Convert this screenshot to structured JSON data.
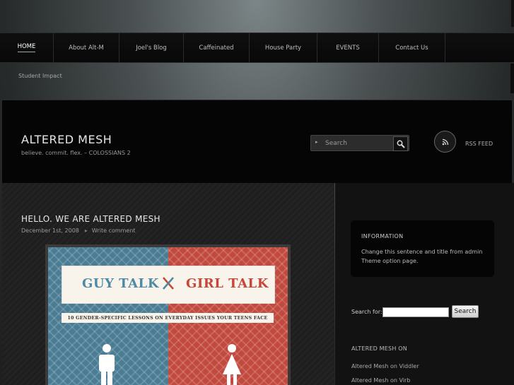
{
  "nav": {
    "items": [
      {
        "label": "HOME"
      },
      {
        "label": "About Alt-M"
      },
      {
        "label": "Joel's Blog"
      },
      {
        "label": "Caffeinated"
      },
      {
        "label": "House Party"
      },
      {
        "label": "EVENTS"
      },
      {
        "label": "Contact Us"
      }
    ],
    "subnav": "Student Impact"
  },
  "header": {
    "title": "ALTERED MESH",
    "tagline": "believe. commit. flex. – COLOSSIANS 2",
    "search_placeholder": "Search",
    "rss_label": "RSS FEED"
  },
  "post": {
    "title": "HELLO. WE ARE ALTERED MESH",
    "date": "December 1st, 2008",
    "comment_link": "Write comment",
    "image": {
      "left_title": "GUY TALK",
      "right_title": "GIRL TALK",
      "subtitle": "10 GENDER-SPECIFIC LESSONS ON EVERYDAY ISSUES YOUR TEENS FACE"
    }
  },
  "sidebar": {
    "info": {
      "title": "INFORMATION",
      "text": "Change this sentence and title from admin Theme option page."
    },
    "search": {
      "label": "Search for:",
      "button": "Search",
      "value": ""
    },
    "altered_mesh_on": {
      "title": "ALTERED MESH ON",
      "links": [
        "Altered Mesh on Viddler",
        "Altered Mesh on Virb"
      ]
    }
  },
  "colors": {
    "guy_blue": "#4d8aa5",
    "girl_red": "#c84638",
    "header_bg": "#050505"
  }
}
